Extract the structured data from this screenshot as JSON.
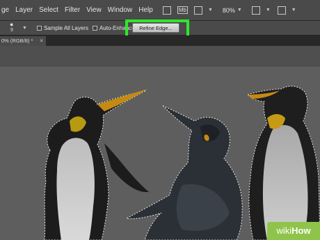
{
  "menu": {
    "items": [
      "ge",
      "Layer",
      "Select",
      "Filter",
      "View",
      "Window",
      "Help"
    ],
    "mb_label": "Mb",
    "zoom": "80%"
  },
  "options": {
    "brush_size": "9",
    "sample_all_layers": "Sample All Layers",
    "auto_enhance": "Auto-Enhance",
    "refine_edge": "Refine Edge..."
  },
  "document": {
    "tab_title": "0% (RGB/8) *",
    "close_glyph": "×"
  },
  "watermark": {
    "prefix": "wiki",
    "suffix": "How"
  },
  "colors": {
    "highlight": "#2ee62b",
    "watermark": "#8fc44a"
  }
}
